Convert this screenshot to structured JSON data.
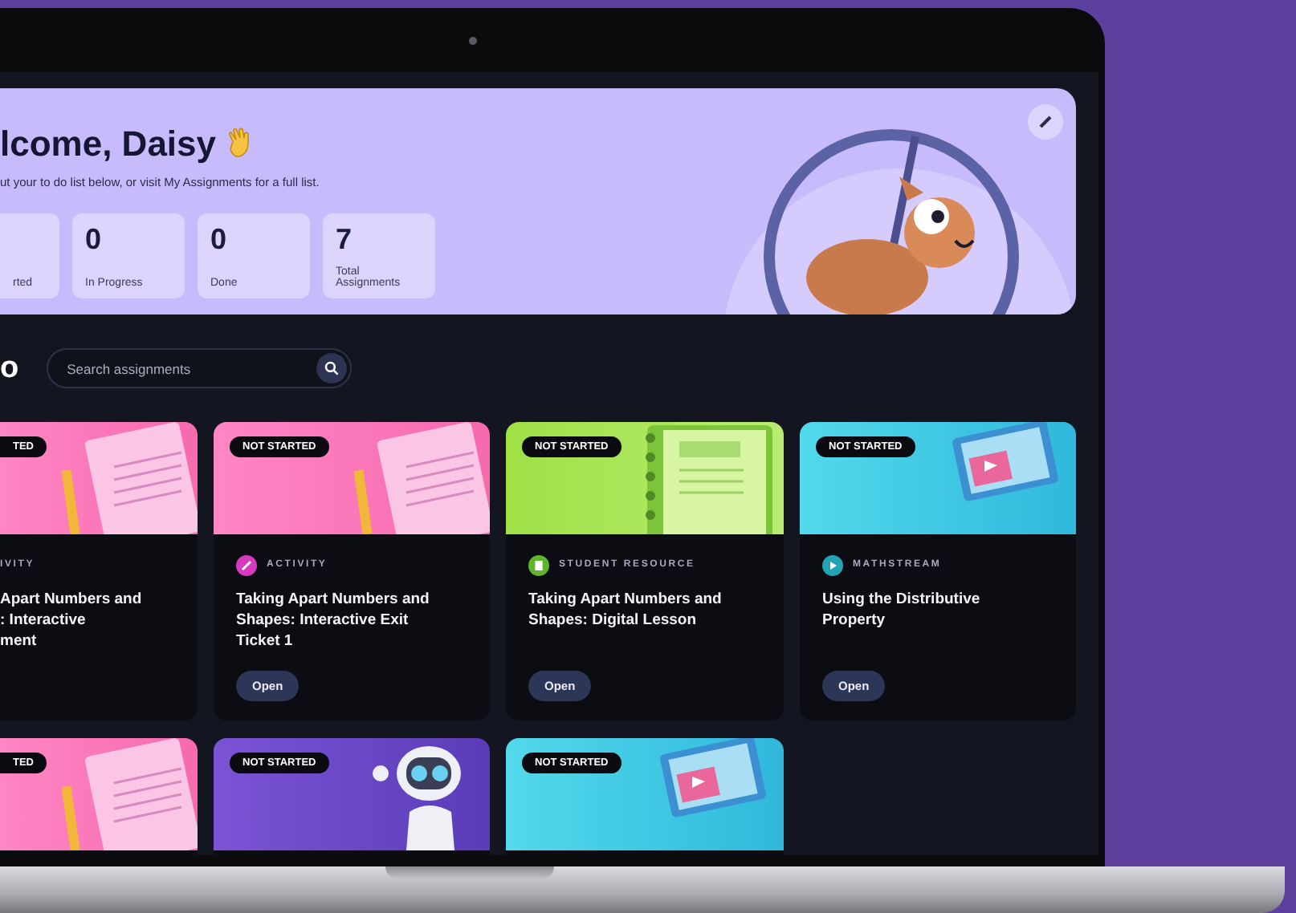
{
  "welcome": {
    "title": "lcome, Daisy",
    "subtitle": "ut your to do list below, or visit My Assignments for a full list."
  },
  "stats": [
    {
      "label": "rted"
    },
    {
      "value": "0",
      "label": "In Progress"
    },
    {
      "value": "0",
      "label": "Done"
    },
    {
      "value": "7",
      "label": "Total Assignments"
    }
  ],
  "heading": "o",
  "search": {
    "placeholder": "Search assignments"
  },
  "cards": [
    {
      "status": "TED",
      "art": {
        "kind": "document"
      },
      "category": {
        "label": "IVITY"
      },
      "title": "Apart Numbers and\n: Interactive\nment"
    },
    {
      "status": "NOT STARTED",
      "art": {
        "kind": "document"
      },
      "category": {
        "kind": "activity",
        "label": "ACTIVITY"
      },
      "title": "Taking Apart Numbers and\nShapes: Interactive Exit\nTicket 1",
      "button": "Open"
    },
    {
      "status": "NOT STARTED",
      "art": {
        "kind": "notebook"
      },
      "category": {
        "kind": "resource",
        "label": "STUDENT RESOURCE"
      },
      "title": "Taking Apart Numbers and\nShapes: Digital Lesson",
      "button": "Open"
    },
    {
      "status": "NOT STARTED",
      "art": {
        "kind": "video"
      },
      "category": {
        "kind": "video",
        "label": "MATHSTREAM"
      },
      "title": "Using the Distributive\nProperty",
      "button": "Open"
    },
    {
      "status": "TED",
      "art": {
        "kind": "document"
      }
    },
    {
      "status": "NOT STARTED",
      "art": {
        "kind": "robot"
      }
    },
    {
      "status": "NOT STARTED",
      "art": {
        "kind": "video"
      }
    }
  ]
}
